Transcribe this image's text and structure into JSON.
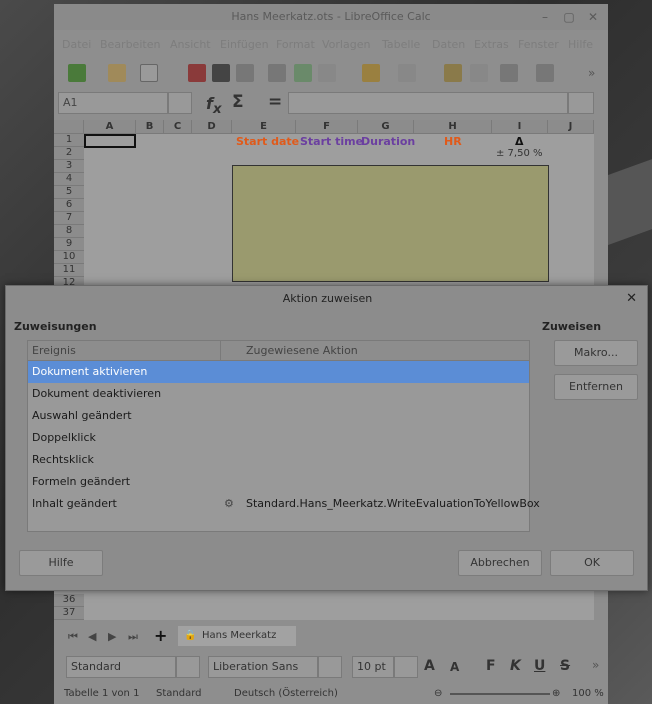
{
  "window": {
    "title": "Hans Meerkatz.ots - LibreOffice Calc"
  },
  "menu": [
    "Datei",
    "Bearbeiten",
    "Ansicht",
    "Einfügen",
    "Format",
    "Vorlagen",
    "Tabelle",
    "Daten",
    "Extras",
    "Fenster",
    "Hilfe"
  ],
  "formula_bar": {
    "name_box": "A1",
    "sigma": "Σ",
    "equals": "=",
    "fx": "f",
    "fx_sub": "x"
  },
  "sheet": {
    "columns": [
      "A",
      "B",
      "C",
      "D",
      "E",
      "F",
      "G",
      "H",
      "I",
      "J"
    ],
    "top_rows": [
      "1",
      "2",
      "3",
      "4",
      "5",
      "6",
      "7",
      "8",
      "9",
      "10",
      "11",
      "12"
    ],
    "bottom_rows": [
      "36",
      "37"
    ],
    "headers": {
      "start_date": "Start date",
      "start_time": "Start time",
      "duration": "Duration",
      "hr": "HR",
      "delta": "Δ"
    },
    "i2_value": "± 7,50  %",
    "tab_name": "Hans Meerkatz"
  },
  "format_bar": {
    "style": "Standard",
    "font": "Liberation Sans",
    "size": "10 pt"
  },
  "status": {
    "sheet": "Tabelle 1 von 1",
    "style": "Standard",
    "language": "Deutsch (Österreich)",
    "zoom": "100 %"
  },
  "dialog": {
    "title": "Aktion zuweisen",
    "assignments_label": "Zuweisungen",
    "assign_label": "Zuweisen",
    "col_event": "Ereignis",
    "col_action": "Zugewiesene Aktion",
    "events": [
      {
        "event": "Dokument aktivieren",
        "action": ""
      },
      {
        "event": "Dokument deaktivieren",
        "action": ""
      },
      {
        "event": "Auswahl geändert",
        "action": ""
      },
      {
        "event": "Doppelklick",
        "action": ""
      },
      {
        "event": "Rechtsklick",
        "action": ""
      },
      {
        "event": "Formeln geändert",
        "action": ""
      },
      {
        "event": "Inhalt geändert",
        "action": "Standard.Hans_Meerkatz.WriteEvaluationToYellowBox"
      }
    ],
    "buttons": {
      "macro": "Makro...",
      "remove": "Entfernen",
      "help": "Hilfe",
      "cancel": "Abbrechen",
      "ok": "OK"
    }
  },
  "colors": {
    "start_date": "#e05a1a",
    "start_time": "#6b3fa0",
    "duration": "#6b3fa0",
    "hr": "#e05a1a",
    "selection": "#5b8dd6",
    "yellow_box": "#ffffa0"
  }
}
